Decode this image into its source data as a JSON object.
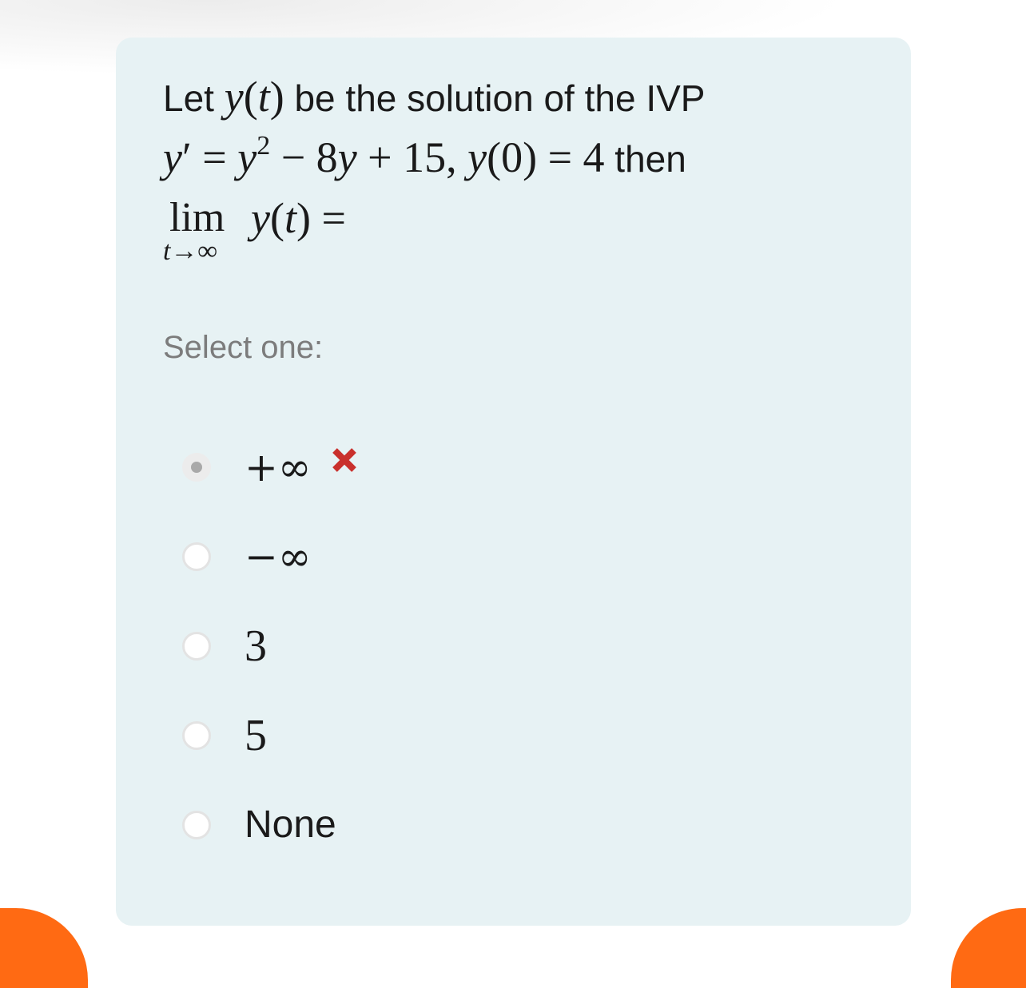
{
  "question": {
    "line1": {
      "prefix": "Let ",
      "func": "y",
      "open": "(",
      "var": "t",
      "close": ")",
      "suffix": " be the solution of the IVP"
    },
    "line2": {
      "y": "y",
      "prime": "′",
      "eq1": " = ",
      "y2": "y",
      "exp": "2",
      "minus": " − 8",
      "y3": "y",
      "plus": " + 15, ",
      "y4": "y",
      "init": "(0)",
      "eq2": " = 4",
      "then": " then"
    },
    "line3": {
      "lim": "lim",
      "lim_sub": "t→∞",
      "func": "y",
      "open": "(",
      "var": "t",
      "close": ")",
      "eq": " ="
    }
  },
  "prompt": "Select one:",
  "options": [
    {
      "label": "+∞",
      "selected": true,
      "marked_wrong": true
    },
    {
      "label": "−∞",
      "selected": false
    },
    {
      "label": "3",
      "selected": false
    },
    {
      "label": "5",
      "selected": false
    },
    {
      "label": "None",
      "selected": false
    }
  ],
  "colors": {
    "card_bg": "#e7f2f4",
    "wrong_mark": "#c9302c",
    "accent_orange": "#ff6a13"
  },
  "icons": {
    "wrong": "cross-icon"
  }
}
